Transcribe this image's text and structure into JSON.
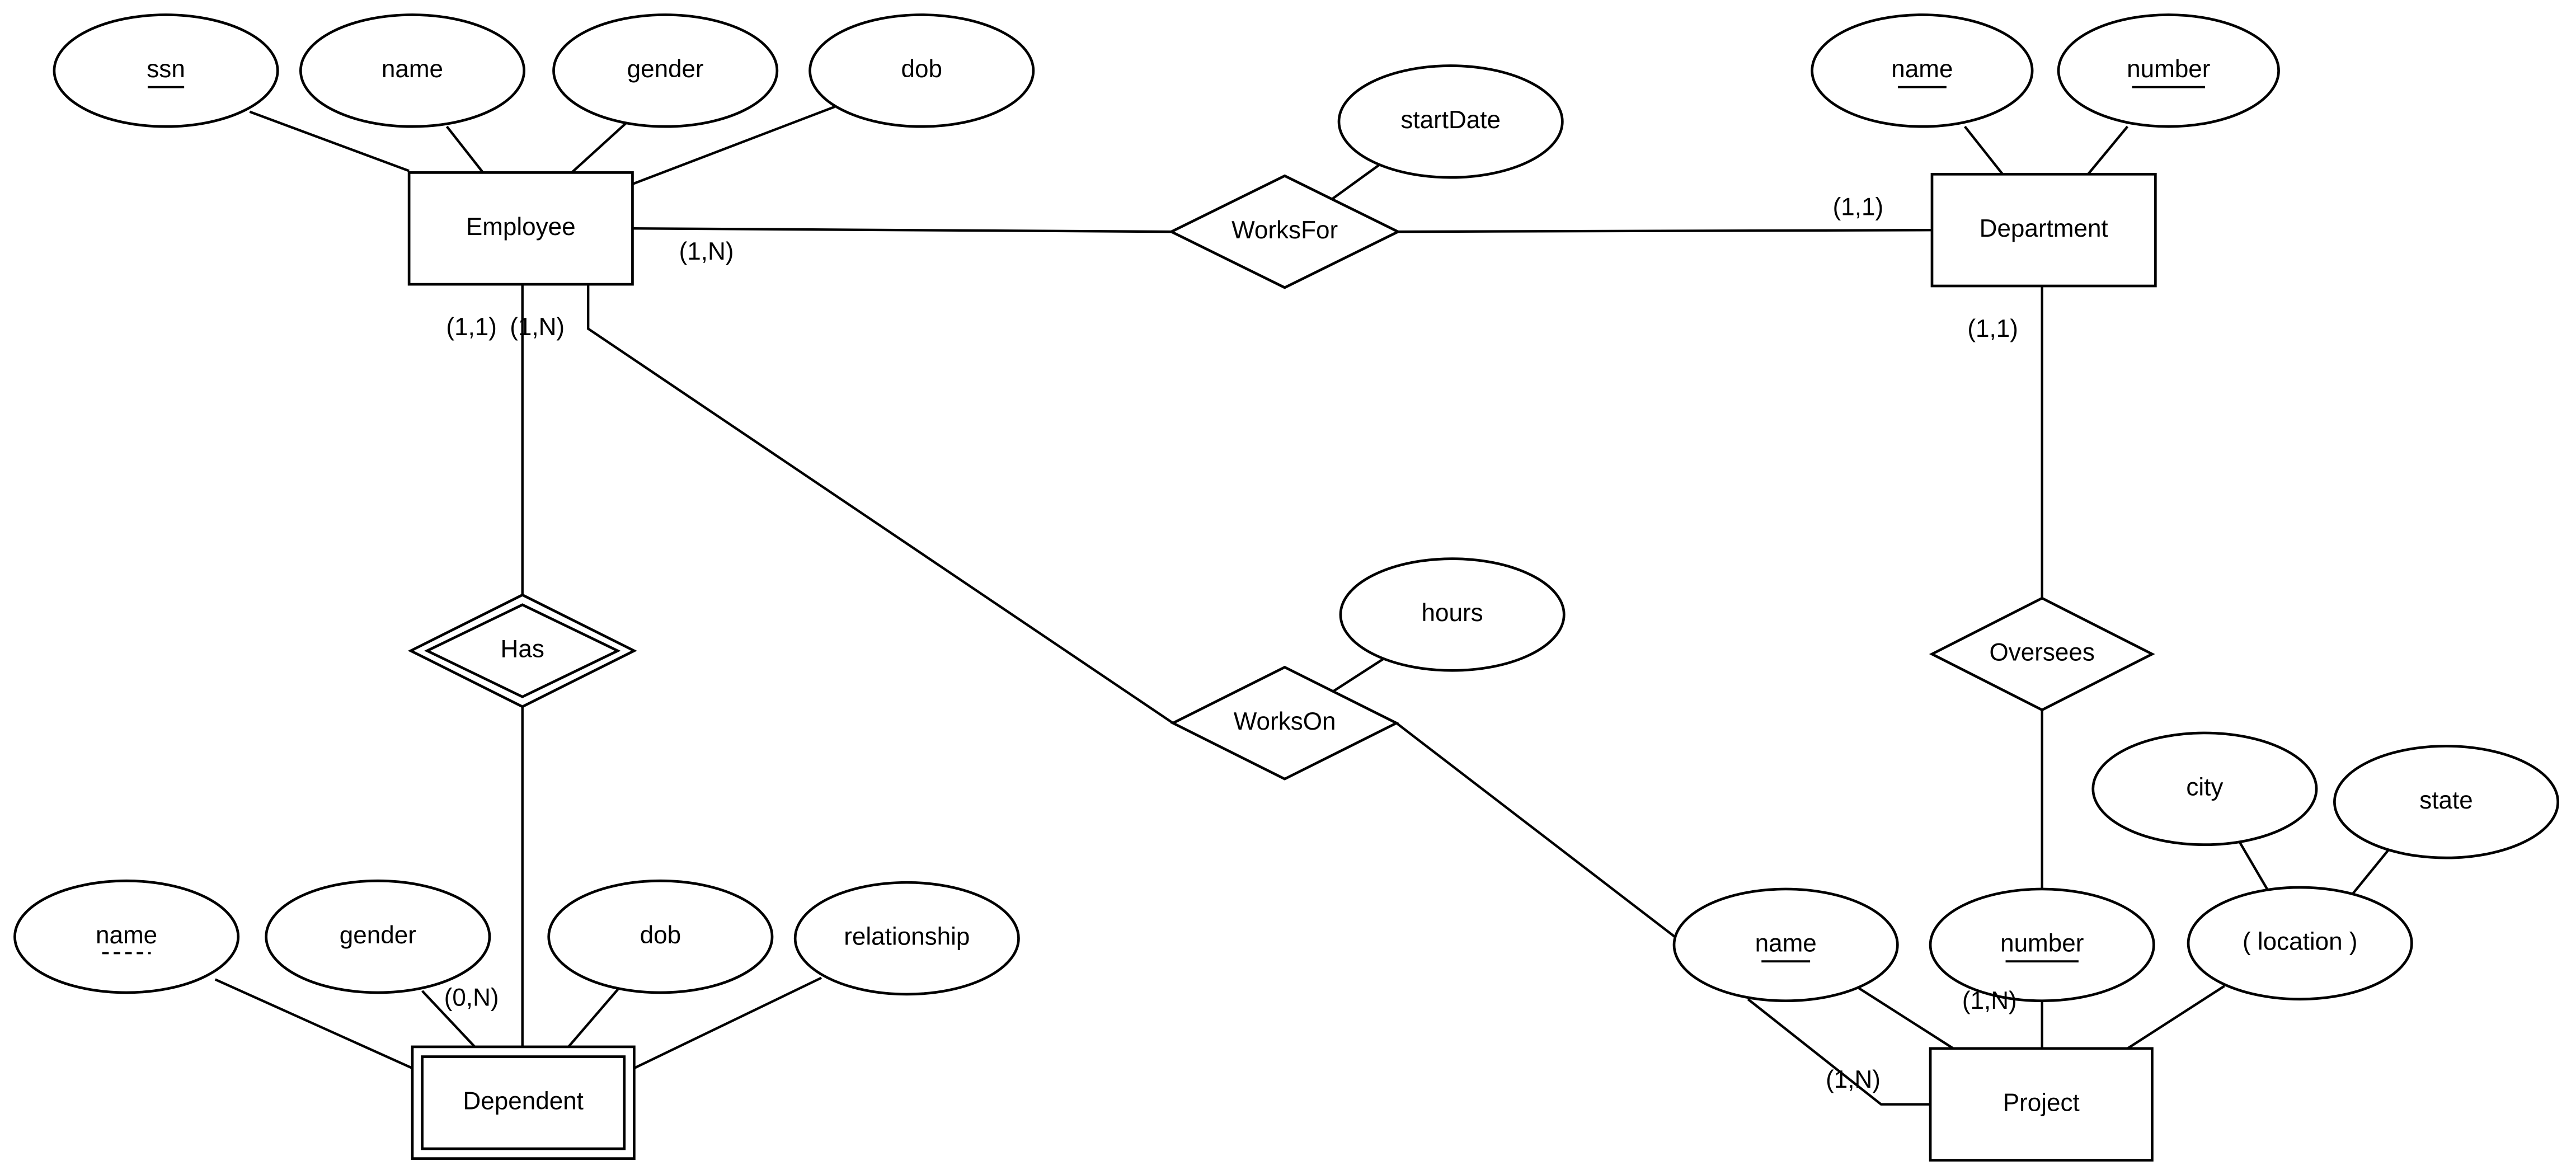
{
  "diagram": {
    "type": "ER diagram",
    "entities": [
      {
        "id": "employee",
        "label": "Employee",
        "weak": false
      },
      {
        "id": "department",
        "label": "Department",
        "weak": false
      },
      {
        "id": "project",
        "label": "Project",
        "weak": false
      },
      {
        "id": "dependent",
        "label": "Dependent",
        "weak": true
      }
    ],
    "relationships": [
      {
        "id": "worksfor",
        "label": "WorksFor",
        "identifying": false
      },
      {
        "id": "workson",
        "label": "WorksOn",
        "identifying": false
      },
      {
        "id": "has",
        "label": "Has",
        "identifying": true
      },
      {
        "id": "oversees",
        "label": "Oversees",
        "identifying": false
      }
    ],
    "attributes": [
      {
        "id": "emp-ssn",
        "label": "ssn",
        "owner": "employee",
        "key": "primary"
      },
      {
        "id": "emp-name",
        "label": "name",
        "owner": "employee",
        "key": "none"
      },
      {
        "id": "emp-gender",
        "label": "gender",
        "owner": "employee",
        "key": "none"
      },
      {
        "id": "emp-dob",
        "label": "dob",
        "owner": "employee",
        "key": "none"
      },
      {
        "id": "wf-startdate",
        "label": "startDate",
        "owner": "worksfor",
        "key": "none"
      },
      {
        "id": "dept-name",
        "label": "name",
        "owner": "department",
        "key": "primary"
      },
      {
        "id": "dept-number",
        "label": "number",
        "owner": "department",
        "key": "primary"
      },
      {
        "id": "wo-hours",
        "label": "hours",
        "owner": "workson",
        "key": "none"
      },
      {
        "id": "dep-name",
        "label": "name",
        "owner": "dependent",
        "key": "partial"
      },
      {
        "id": "dep-gender",
        "label": "gender",
        "owner": "dependent",
        "key": "none"
      },
      {
        "id": "dep-dob",
        "label": "dob",
        "owner": "dependent",
        "key": "none"
      },
      {
        "id": "dep-relationship",
        "label": "relationship",
        "owner": "dependent",
        "key": "none"
      },
      {
        "id": "proj-name",
        "label": "name",
        "owner": "project",
        "key": "primary"
      },
      {
        "id": "proj-number",
        "label": "number",
        "owner": "project",
        "key": "primary"
      },
      {
        "id": "proj-location",
        "label": "( location )",
        "owner": "project",
        "key": "multivalued"
      },
      {
        "id": "loc-city",
        "label": "city",
        "owner": "proj-location",
        "key": "none"
      },
      {
        "id": "loc-state",
        "label": "state",
        "owner": "proj-location",
        "key": "none"
      }
    ],
    "cardinalities": [
      {
        "id": "c-emp-worksfor",
        "label": "(1,N)"
      },
      {
        "id": "c-dept-worksfor",
        "label": "(1,1)"
      },
      {
        "id": "c-emp-has",
        "label": "(1,1)"
      },
      {
        "id": "c-emp-workson",
        "label": "(1,N)"
      },
      {
        "id": "c-dept-oversees",
        "label": "(1,1)"
      },
      {
        "id": "c-dep-has",
        "label": "(0,N)"
      },
      {
        "id": "c-proj-oversees",
        "label": "(1,N)"
      },
      {
        "id": "c-proj-workson",
        "label": "(1,N)"
      }
    ]
  }
}
